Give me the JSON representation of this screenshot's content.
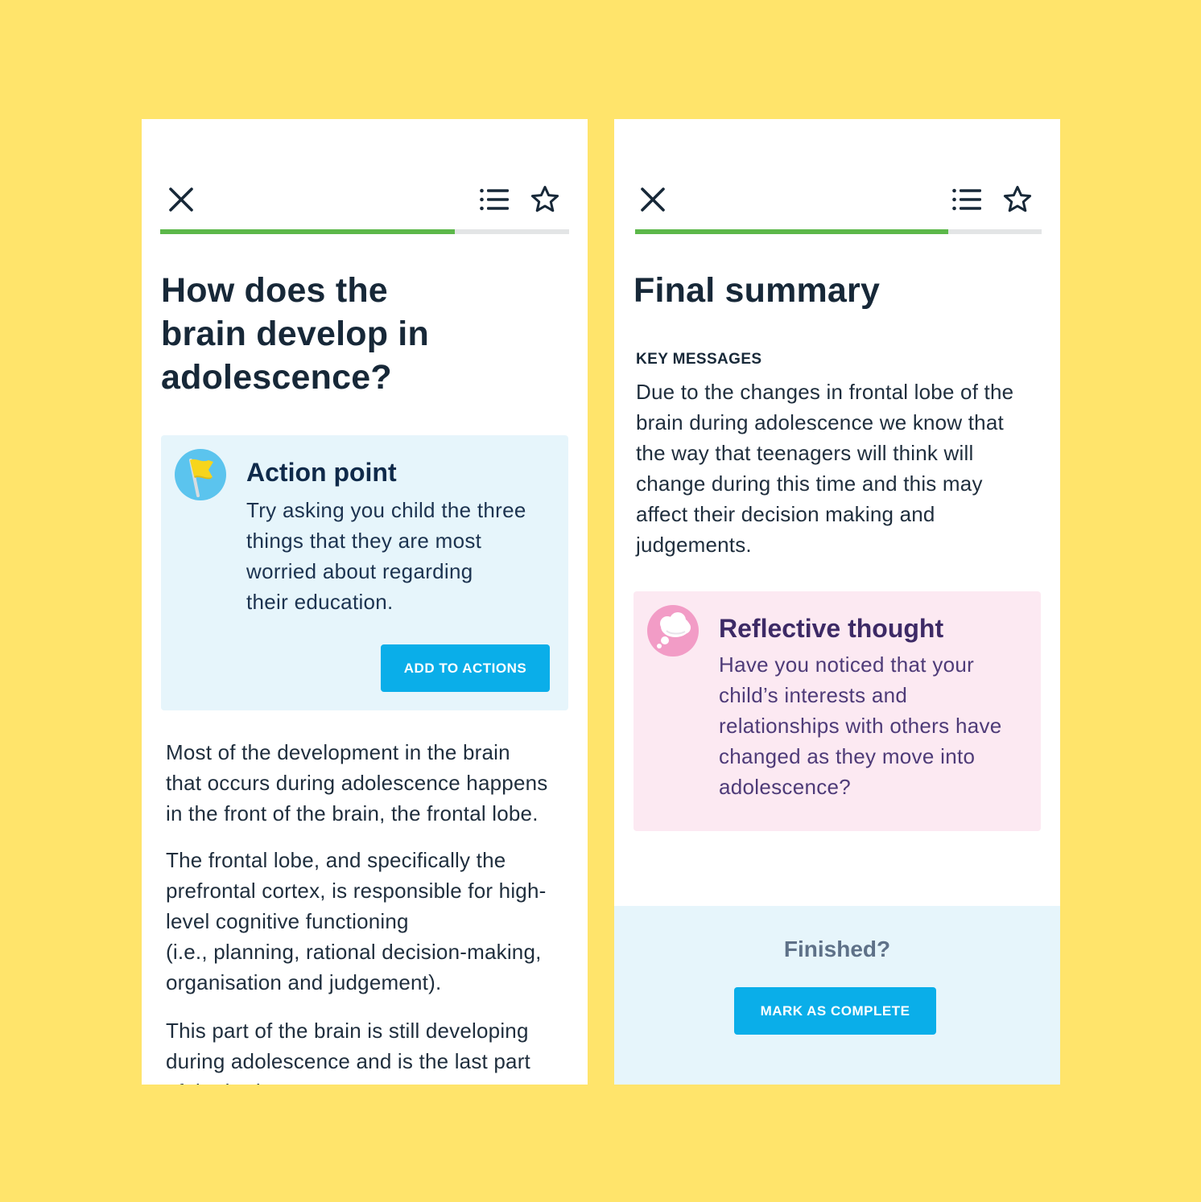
{
  "colors": {
    "background": "#FFE46B",
    "progress": "#5CB84A",
    "button": "#0AAEE9",
    "action_card": "#E6F5FB",
    "reflect_card": "#FCE9F2",
    "reflect_title": "#3D2A66"
  },
  "left_screen": {
    "toolbar": {
      "close_icon": "close-icon",
      "contents_icon": "list-icon",
      "bookmark_icon": "star-icon"
    },
    "progress": 0.72,
    "title_lines": [
      "How does the",
      "brain develop in",
      "adolescence?"
    ],
    "action_card": {
      "icon": "flag-icon",
      "title": "Action point",
      "body_lines": [
        "Try asking you child the three",
        "things that they are most",
        "worried about regarding",
        "their education."
      ],
      "button_label": "ADD TO ACTIONS"
    },
    "paragraphs": [
      [
        "Most of the development in the brain",
        "that occurs during adolescence happens",
        "in the front of the brain, the frontal lobe."
      ],
      [
        "The frontal lobe, and specifically the",
        "prefrontal cortex, is responsible for high-",
        "level cognitive functioning",
        "(i.e., planning, rational decision-making,",
        "organisation and judgement)."
      ],
      [
        "This part of the brain is still developing",
        "during adolescence and is the last part",
        "of the brain to"
      ]
    ]
  },
  "right_screen": {
    "toolbar": {
      "close_icon": "close-icon",
      "contents_icon": "list-icon",
      "bookmark_icon": "star-icon"
    },
    "progress": 0.77,
    "title": "Final summary",
    "key_messages_label": "KEY MESSAGES",
    "key_messages_lines": [
      "Due to the changes in frontal lobe of the",
      "brain during adolescence we know that",
      "the way that teenagers will think will",
      "change during this time and this may",
      "affect their decision making and",
      "judgements."
    ],
    "reflect_card": {
      "icon": "thought-bubble-icon",
      "title": "Reflective thought",
      "body_lines": [
        "Have you noticed that your",
        "child’s interests and",
        "relationships with others have",
        "changed as they move into",
        "adolescence?"
      ]
    },
    "finish": {
      "label": "Finished?",
      "button_label": "MARK AS COMPLETE"
    }
  }
}
